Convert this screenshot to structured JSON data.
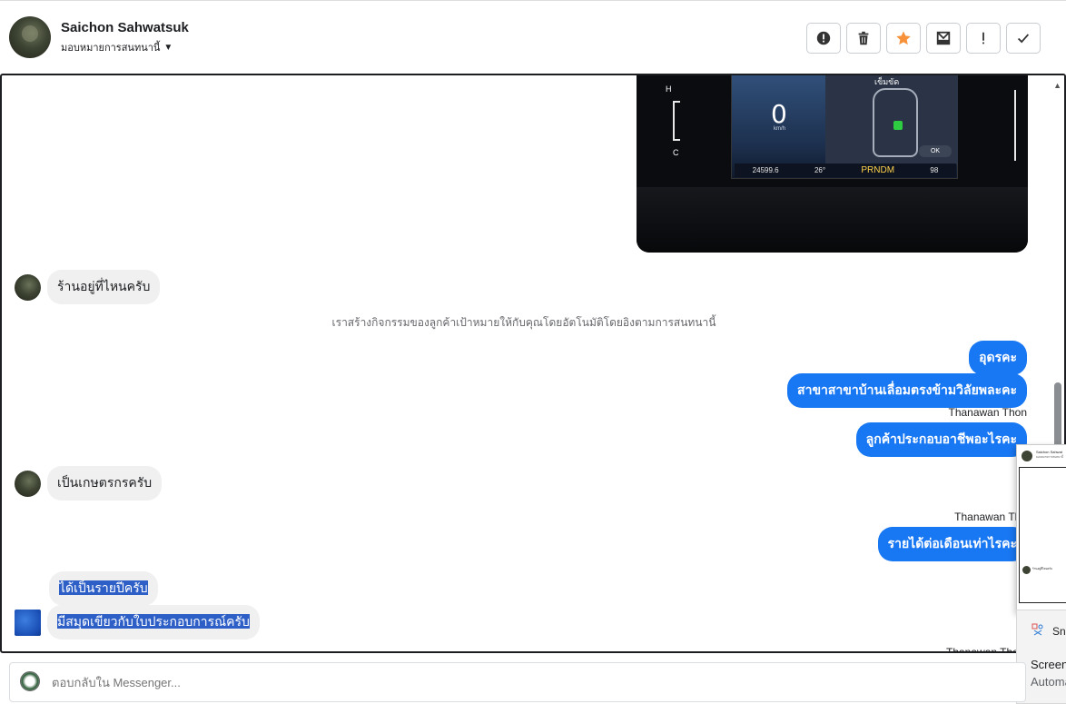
{
  "header": {
    "contact_name": "Saichon Sahwatsuk",
    "assign_label": "มอบหมายการสนทนานี้",
    "actions": [
      {
        "name": "spam-button",
        "icon": "alert-circle-icon",
        "glyph": "!"
      },
      {
        "name": "delete-button",
        "icon": "trash-icon",
        "glyph": "🗑"
      },
      {
        "name": "star-button",
        "icon": "star-icon",
        "glyph": "★"
      },
      {
        "name": "mark-unread-button",
        "icon": "mail-icon",
        "glyph": "✉"
      },
      {
        "name": "follow-up-button",
        "icon": "exclamation-icon",
        "glyph": "!"
      },
      {
        "name": "done-button",
        "icon": "check-icon",
        "glyph": "✓"
      }
    ]
  },
  "photo": {
    "speed": "0",
    "speed_unit": "km/h",
    "gauge_title": "เข็มขัด",
    "odometer": "24599.6",
    "temp": "26°",
    "gear": "PRNDM",
    "range": "98",
    "ok_label": "OK",
    "h_label": "H",
    "c_label": "C"
  },
  "messages": {
    "m1": "ร้านอยู่ที่ไหนครับ",
    "system": "เราสร้างกิจกรรมของลูกค้าเป้าหมายให้กับคุณโดยอัตโนมัติโดยอิงตามการสนทนานี้",
    "m2": "อุดรคะ",
    "m3": "สาขาสาขาบ้านเลื่อมตรงข้ามวิลัยพละคะ",
    "sender1": "Thanawan Thon",
    "m4": "ลูกค้าประกอบอาชีพอะไรคะ",
    "m5": "เป็นเกษตรกรครับ",
    "sender2": "Thanawan Tho",
    "m6": "รายได้ต่อเดือนเท่าไรคะ",
    "m7": "ได้เป็นรายปีครับ",
    "m8": "มีสมุดเขียวกับใบประกอบการณ์ครับ",
    "cut": "Thanawan Tho"
  },
  "popup": {
    "name": "Saichon Sahwat",
    "sub": "มอบหมายการสนทนานี้",
    "msg": "ร้านอยู่ที่ไหนครับ"
  },
  "toast": {
    "app": "Snipping Tool",
    "title": "Screenshot copied to clipboard",
    "sub": "Automatically saved to screenshots folder"
  },
  "composer": {
    "placeholder": "ตอบกลับใน Messenger..."
  }
}
